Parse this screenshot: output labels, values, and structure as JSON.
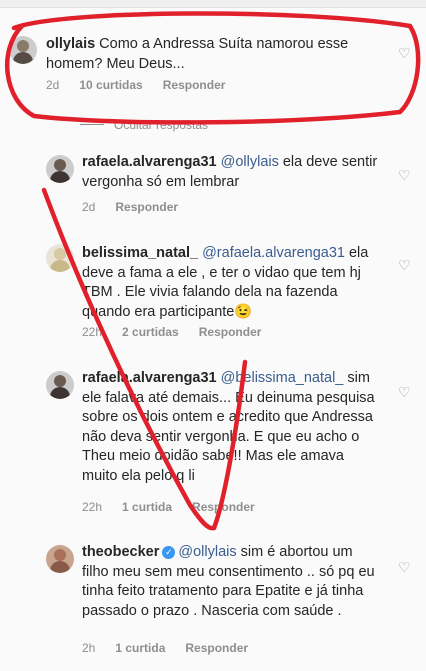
{
  "comments": [
    {
      "username": "ollylais",
      "mention": "",
      "text": "Como a Andressa Suíta namorou esse homem? Meu Deus...",
      "time": "2d",
      "likes": "10 curtidas",
      "reply": "Responder"
    },
    {
      "username": "rafaela.alvarenga31",
      "mention": "@ollylais",
      "text": "ela deve sentir vergonha  só em lembrar",
      "time": "2d",
      "likes": "",
      "reply": "Responder"
    },
    {
      "username": "belissima_natal_",
      "mention": "@rafaela.alvarenga31",
      "text": "ela deve a fama a ele , e ter o vidao que tem hj TBM . Ele vivia falando dela na fazenda quando era participante😉",
      "time": "22h",
      "likes": "2 curtidas",
      "reply": "Responder"
    },
    {
      "username": "rafaela.alvarenga31",
      "mention": "@belissima_natal_",
      "text": "sim ele falava até demais... Eu deinuma pesquisa sobre os dois ontem e acredito que Andressa não deva sentir vergonha. E que eu acho o Theu meio doidão sabe!! Mas ele amava muito ela pelo q li",
      "time": "22h",
      "likes": "1 curtida",
      "reply": "Responder"
    },
    {
      "username": "theobecker",
      "verified": "✓",
      "mention": "@ollylais",
      "text": "sim é abortou um filho meu sem meu consentimento .. só pq eu tinha feito tratamento para Epatite e já tinha passado o prazo . Nasceria com saúde .",
      "time": "2h",
      "likes": "1 curtida",
      "reply": "Responder"
    }
  ],
  "hide_replies": "Ocultar respostas",
  "icons": {
    "like": "heart-outline-icon",
    "verified": "verified-badge-icon"
  },
  "annotation_color": "#e0202a"
}
